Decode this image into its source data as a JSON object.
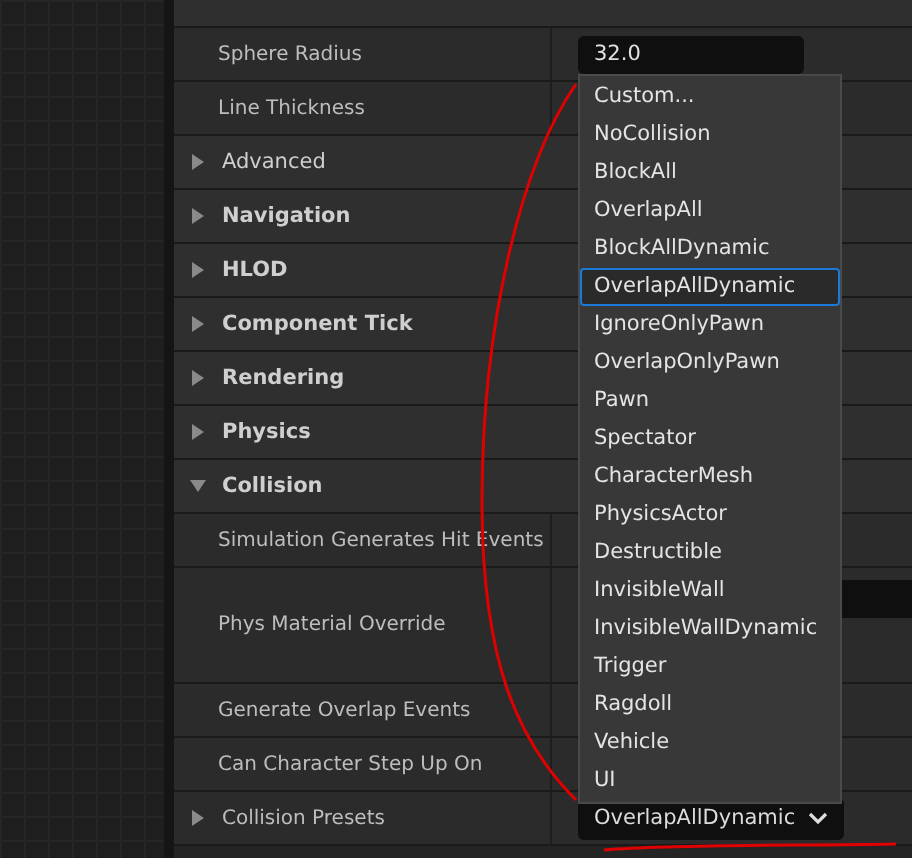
{
  "details": {
    "rows": [
      {
        "kind": "property",
        "label": "Sphere Radius",
        "value": "32.0"
      },
      {
        "kind": "property",
        "label": "Line Thickness"
      },
      {
        "kind": "category",
        "label": "Advanced",
        "expanded": false,
        "bold": false
      },
      {
        "kind": "category",
        "label": "Navigation",
        "expanded": false,
        "bold": true
      },
      {
        "kind": "category",
        "label": "HLOD",
        "expanded": false,
        "bold": true
      },
      {
        "kind": "category",
        "label": "Component Tick",
        "expanded": false,
        "bold": true
      },
      {
        "kind": "category",
        "label": "Rendering",
        "expanded": false,
        "bold": true
      },
      {
        "kind": "category",
        "label": "Physics",
        "expanded": false,
        "bold": true
      },
      {
        "kind": "category",
        "label": "Collision",
        "expanded": true,
        "bold": true
      },
      {
        "kind": "property",
        "label": "Simulation Generates Hit Events"
      },
      {
        "kind": "tall",
        "label": "Phys Material Override"
      },
      {
        "kind": "property",
        "label": "Generate Overlap Events"
      },
      {
        "kind": "property",
        "label": "Can Character Step Up On"
      },
      {
        "kind": "combo",
        "label": "Collision Presets",
        "expanded": false,
        "value": "OverlapAllDynamic"
      }
    ]
  },
  "dropdown": {
    "items": [
      {
        "label": "Custom...",
        "selected": false
      },
      {
        "label": "NoCollision",
        "selected": false
      },
      {
        "label": "BlockAll",
        "selected": false
      },
      {
        "label": "OverlapAll",
        "selected": false
      },
      {
        "label": "BlockAllDynamic",
        "selected": false
      },
      {
        "label": "OverlapAllDynamic",
        "selected": true
      },
      {
        "label": "IgnoreOnlyPawn",
        "selected": false
      },
      {
        "label": "OverlapOnlyPawn",
        "selected": false
      },
      {
        "label": "Pawn",
        "selected": false
      },
      {
        "label": "Spectator",
        "selected": false
      },
      {
        "label": "CharacterMesh",
        "selected": false
      },
      {
        "label": "PhysicsActor",
        "selected": false
      },
      {
        "label": "Destructible",
        "selected": false
      },
      {
        "label": "InvisibleWall",
        "selected": false
      },
      {
        "label": "InvisibleWallDynamic",
        "selected": false
      },
      {
        "label": "Trigger",
        "selected": false
      },
      {
        "label": "Ragdoll",
        "selected": false
      },
      {
        "label": "Vehicle",
        "selected": false
      },
      {
        "label": "UI",
        "selected": false
      }
    ]
  }
}
